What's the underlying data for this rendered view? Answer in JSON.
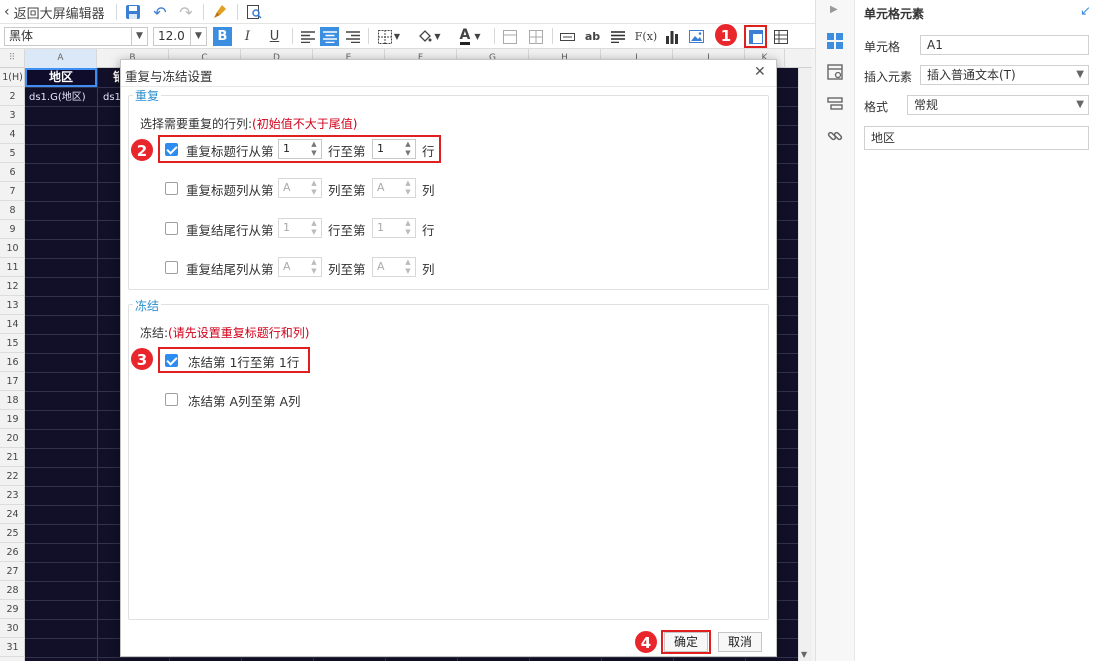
{
  "toolbar": {
    "back_label": "返回大屏编辑器",
    "font_family": "黑体",
    "font_size": "12.0",
    "bold": "B",
    "italic": "I",
    "underline": "U",
    "text_ab": "ab",
    "formula": "F(x)"
  },
  "sheet": {
    "columns": [
      "A",
      "B",
      "C",
      "D",
      "E",
      "F",
      "G",
      "H",
      "I",
      "J",
      "K"
    ],
    "rows": [
      "1(H)",
      "2",
      "3",
      "4",
      "5",
      "6",
      "7",
      "8",
      "9",
      "10",
      "11",
      "12",
      "13",
      "14",
      "15",
      "16",
      "17",
      "18",
      "19",
      "20",
      "21",
      "22",
      "23",
      "24",
      "25",
      "26",
      "27",
      "28",
      "29",
      "30",
      "31"
    ],
    "a1_value": "地区",
    "b1_value": "销",
    "a2_value": "ds1.G(地区)",
    "b2_value": "ds1"
  },
  "right_panel": {
    "title": "单元格元素",
    "cell_label": "单元格",
    "cell_value": "A1",
    "insert_label": "插入元素",
    "insert_value": "插入普通文本(T)",
    "format_label": "格式",
    "format_value": "常规",
    "content_value": "地区"
  },
  "dialog": {
    "title": "重复与冻结设置",
    "close": "✕",
    "repeat_section": "重复",
    "repeat_hint": "选择需要重复的行列:",
    "repeat_hint_red": "(初始值不大于尾值)",
    "options": [
      {
        "label": "重复标题行从第",
        "from": "1",
        "mid": "行至第",
        "to": "1",
        "end": "行",
        "checked": true
      },
      {
        "label": "重复标题列从第",
        "from": "A",
        "mid": "列至第",
        "to": "A",
        "end": "列",
        "checked": false
      },
      {
        "label": "重复结尾行从第",
        "from": "1",
        "mid": "行至第",
        "to": "1",
        "end": "行",
        "checked": false
      },
      {
        "label": "重复结尾列从第",
        "from": "A",
        "mid": "列至第",
        "to": "A",
        "end": "列",
        "checked": false
      }
    ],
    "freeze_section": "冻结",
    "freeze_hint": "冻结:",
    "freeze_hint_red": "(请先设置重复标题行和列)",
    "freeze_rows": "冻结第 1行至第 1行",
    "freeze_cols": "冻结第 A列至第 A列",
    "ok": "确定",
    "cancel": "取消"
  },
  "badges": [
    "1",
    "2",
    "3",
    "4"
  ],
  "colors": {
    "sheet_bg": "#121028",
    "section_blue": "#2c90cf",
    "hint_red": "#d0021b",
    "callout_red": "#e02020",
    "check_blue": "#2d8cf0"
  }
}
